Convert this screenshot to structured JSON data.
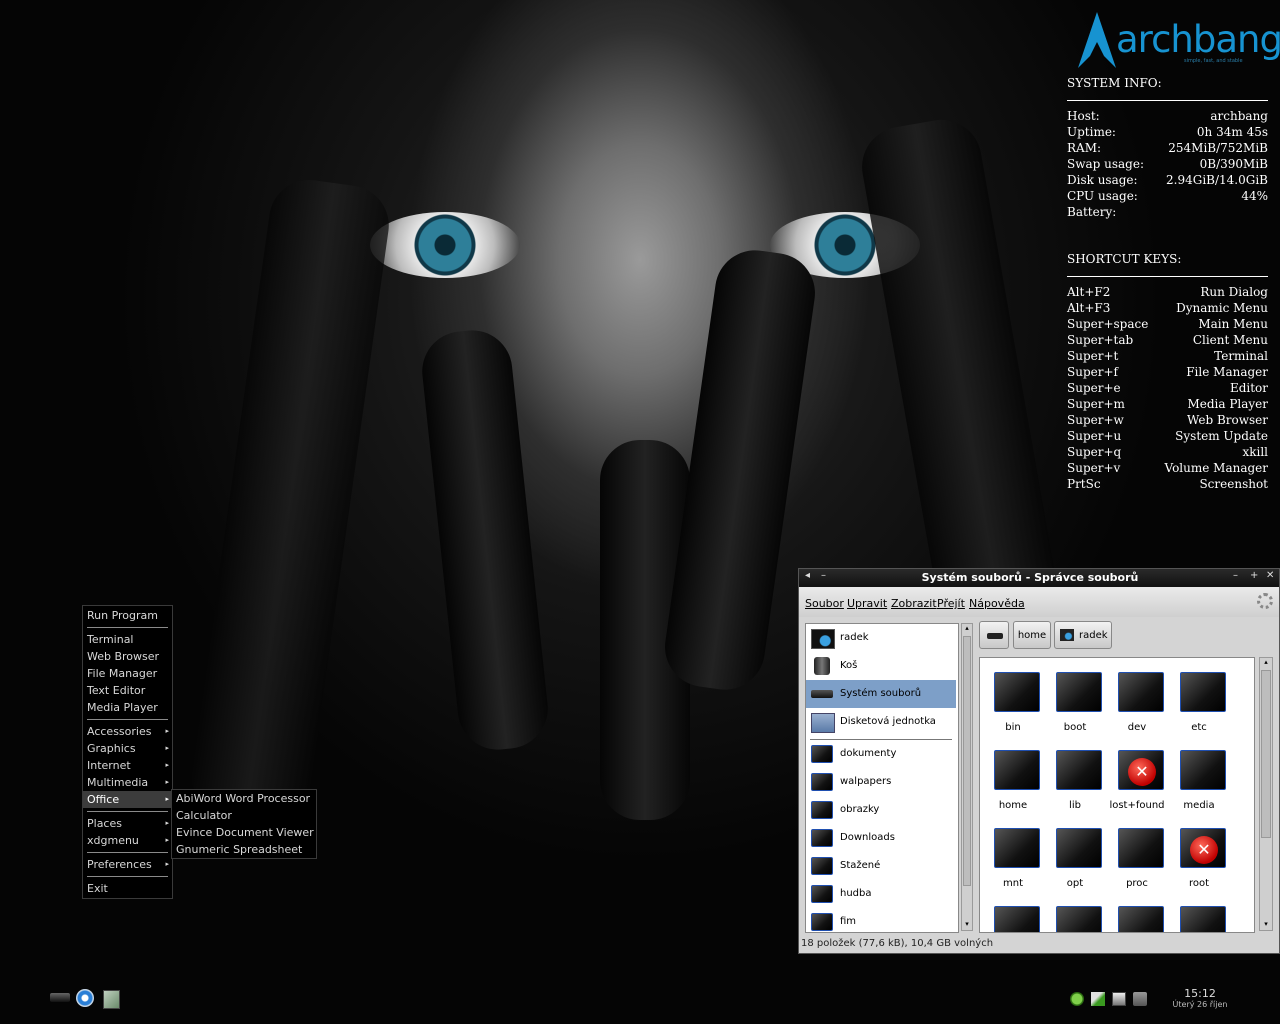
{
  "conky": {
    "logo_word": "archbang",
    "logo_tagline": "simple, fast, and stable",
    "system_info_title": "SYSTEM INFO:",
    "system_info": [
      {
        "label": "Host:",
        "value": "archbang"
      },
      {
        "label": "Uptime:",
        "value": "0h 34m 45s"
      },
      {
        "label": "RAM:",
        "value": "254MiB/752MiB"
      },
      {
        "label": "Swap usage:",
        "value": "0B/390MiB"
      },
      {
        "label": "Disk usage:",
        "value": "2.94GiB/14.0GiB"
      },
      {
        "label": "CPU usage:",
        "value": "44%"
      },
      {
        "label": "Battery:",
        "value": ""
      }
    ],
    "shortcuts_title": "SHORTCUT KEYS:",
    "shortcuts": [
      {
        "key": "Alt+F2",
        "action": "Run Dialog"
      },
      {
        "key": "Alt+F3",
        "action": "Dynamic Menu"
      },
      {
        "key": "Super+space",
        "action": "Main Menu"
      },
      {
        "key": "Super+tab",
        "action": "Client Menu"
      },
      {
        "key": "Super+t",
        "action": "Terminal"
      },
      {
        "key": "Super+f",
        "action": "File Manager"
      },
      {
        "key": "Super+e",
        "action": "Editor"
      },
      {
        "key": "Super+m",
        "action": "Media Player"
      },
      {
        "key": "Super+w",
        "action": "Web Browser"
      },
      {
        "key": "Super+u",
        "action": "System Update"
      },
      {
        "key": "Super+q",
        "action": "xkill"
      },
      {
        "key": "Super+v",
        "action": "Volume Manager"
      },
      {
        "key": "PrtSc",
        "action": "Screenshot"
      }
    ]
  },
  "menu": {
    "run_program": "Run Program",
    "apps": [
      "Terminal",
      "Web Browser",
      "File Manager",
      "Text Editor",
      "Media Player"
    ],
    "categories": [
      "Accessories",
      "Graphics",
      "Internet",
      "Multimedia",
      "Office"
    ],
    "places": "Places",
    "xdgmenu": "xdgmenu",
    "preferences": "Preferences",
    "exit": "Exit",
    "office_submenu": [
      "AbiWord Word Processor",
      "Calculator",
      "Evince Document Viewer",
      "Gnumeric Spreadsheet"
    ],
    "submenu_arrow": "▸"
  },
  "file_manager": {
    "title": "Systém souborů - Správce souborů",
    "menubar": [
      "Soubor",
      "Upravit",
      "Zobrazit",
      "Přejít",
      "Nápověda"
    ],
    "sidebar_top": [
      "radek",
      "Koš",
      "Systém souborů",
      "Disketová jednotka"
    ],
    "sidebar_bookmarks": [
      "dokumenty",
      "walpapers",
      "obrazky",
      "Downloads",
      "Stažené",
      "hudba",
      "fim"
    ],
    "path": [
      "home",
      "radek"
    ],
    "folders": [
      {
        "name": "bin",
        "locked": false
      },
      {
        "name": "boot",
        "locked": false
      },
      {
        "name": "dev",
        "locked": false
      },
      {
        "name": "etc",
        "locked": false
      },
      {
        "name": "home",
        "locked": false
      },
      {
        "name": "lib",
        "locked": false
      },
      {
        "name": "lost+found",
        "locked": true
      },
      {
        "name": "media",
        "locked": false
      },
      {
        "name": "mnt",
        "locked": false
      },
      {
        "name": "opt",
        "locked": false
      },
      {
        "name": "proc",
        "locked": false
      },
      {
        "name": "root",
        "locked": true
      }
    ],
    "status": "18 položek (77,6 kB), 10,4 GB volných"
  },
  "taskbar": {
    "time": "15:12",
    "date": "Úterý 26 říjen"
  },
  "colors": {
    "arch_blue": "#1793d1",
    "selection": "#7d9fc8"
  }
}
